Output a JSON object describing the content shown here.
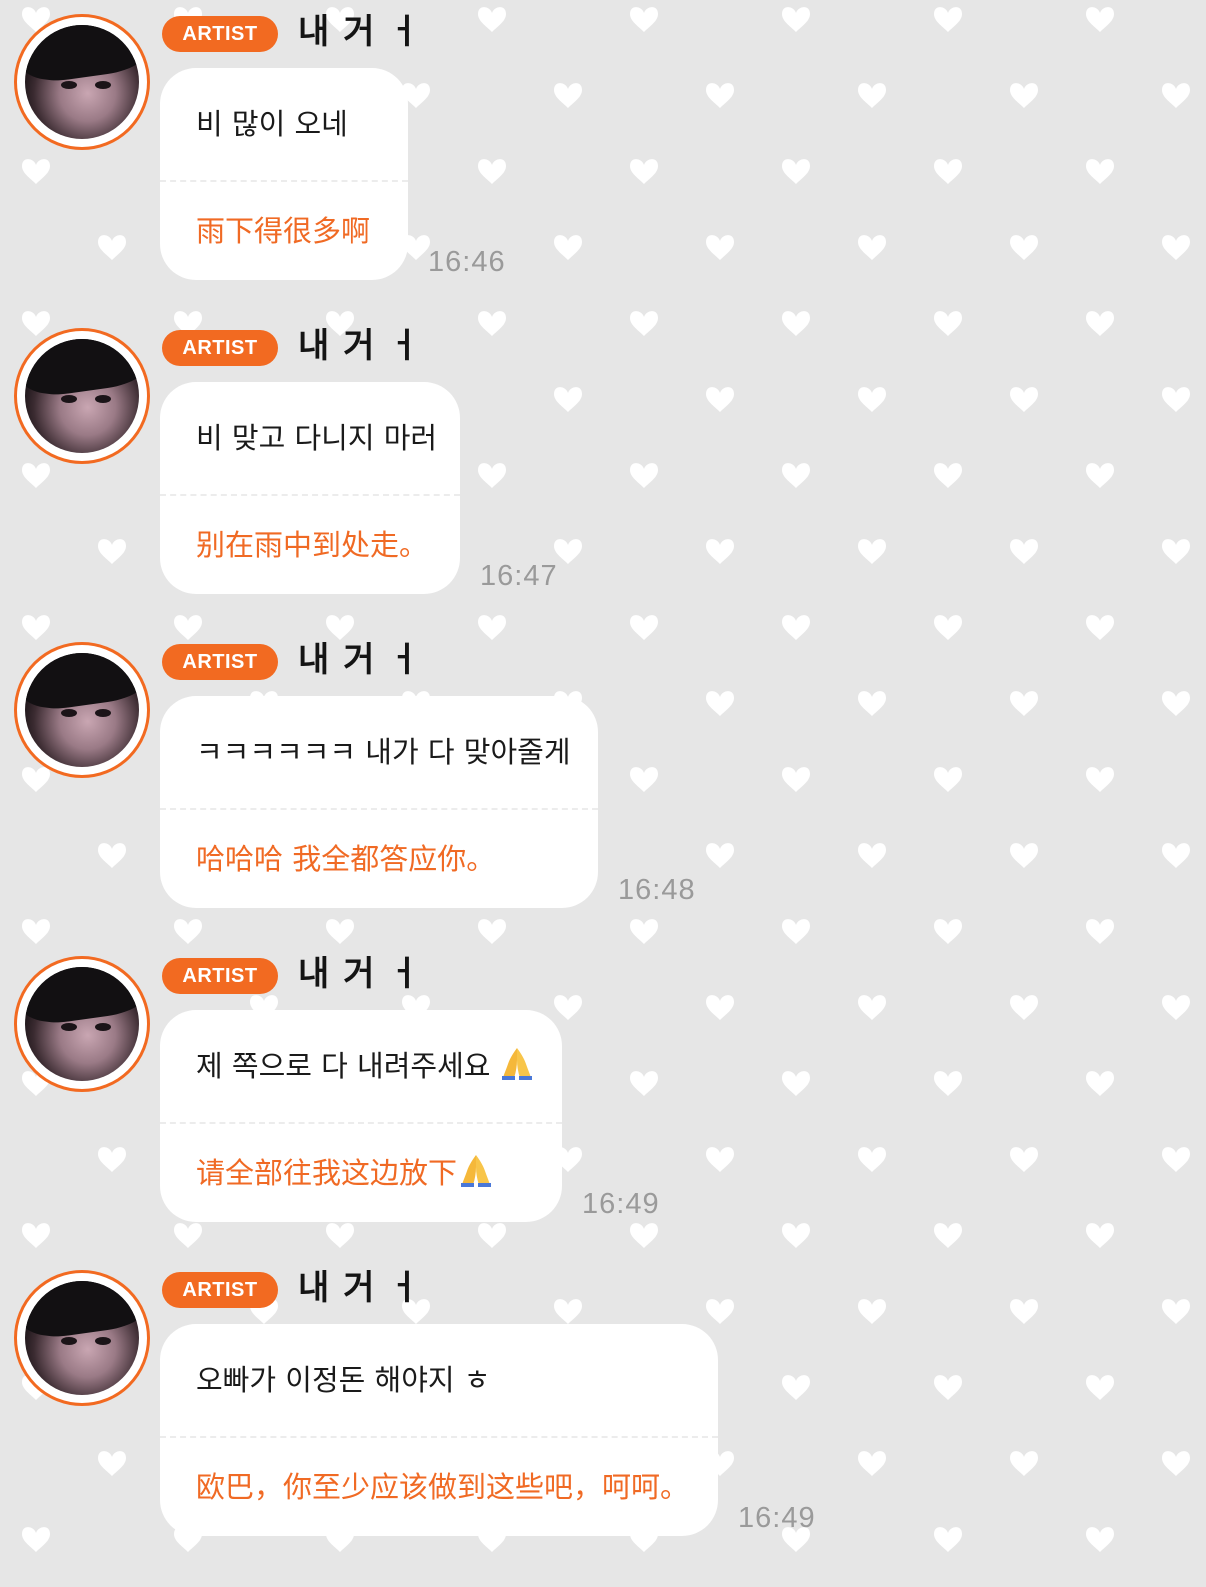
{
  "messages": [
    {
      "badge": "ARTIST",
      "sender": "내 거 ㅓ",
      "korean": "비 많이 오네",
      "chinese": "雨下得很多啊",
      "time": "16:46"
    },
    {
      "badge": "ARTIST",
      "sender": "내 거 ㅓ",
      "korean": "비 맞고 다니지 마러",
      "chinese": "别在雨中到处走。",
      "time": "16:47"
    },
    {
      "badge": "ARTIST",
      "sender": "내 거 ㅓ",
      "korean": "ㅋㅋㅋㅋㅋㅋ 내가 다 맞아줄게",
      "chinese": "哈哈哈 我全都答应你。",
      "time": "16:48"
    },
    {
      "badge": "ARTIST",
      "sender": "내 거 ㅓ",
      "korean": "제 쪽으로 다 내려주세요",
      "chinese": "请全部往我这边放下",
      "emoji_icon": "folded-hands-icon",
      "time": "16:49"
    },
    {
      "badge": "ARTIST",
      "sender": "내 거 ㅓ",
      "korean": "오빠가 이정돈 해야지 ㅎ",
      "chinese": "欧巴，你至少应该做到这些吧，呵呵。",
      "time": "16:49"
    }
  ],
  "colors": {
    "accent": "#f26a21",
    "translation": "#f06a24",
    "background": "#e6e6e6",
    "bubble": "#ffffff",
    "timestamp": "#9a9a9a"
  }
}
